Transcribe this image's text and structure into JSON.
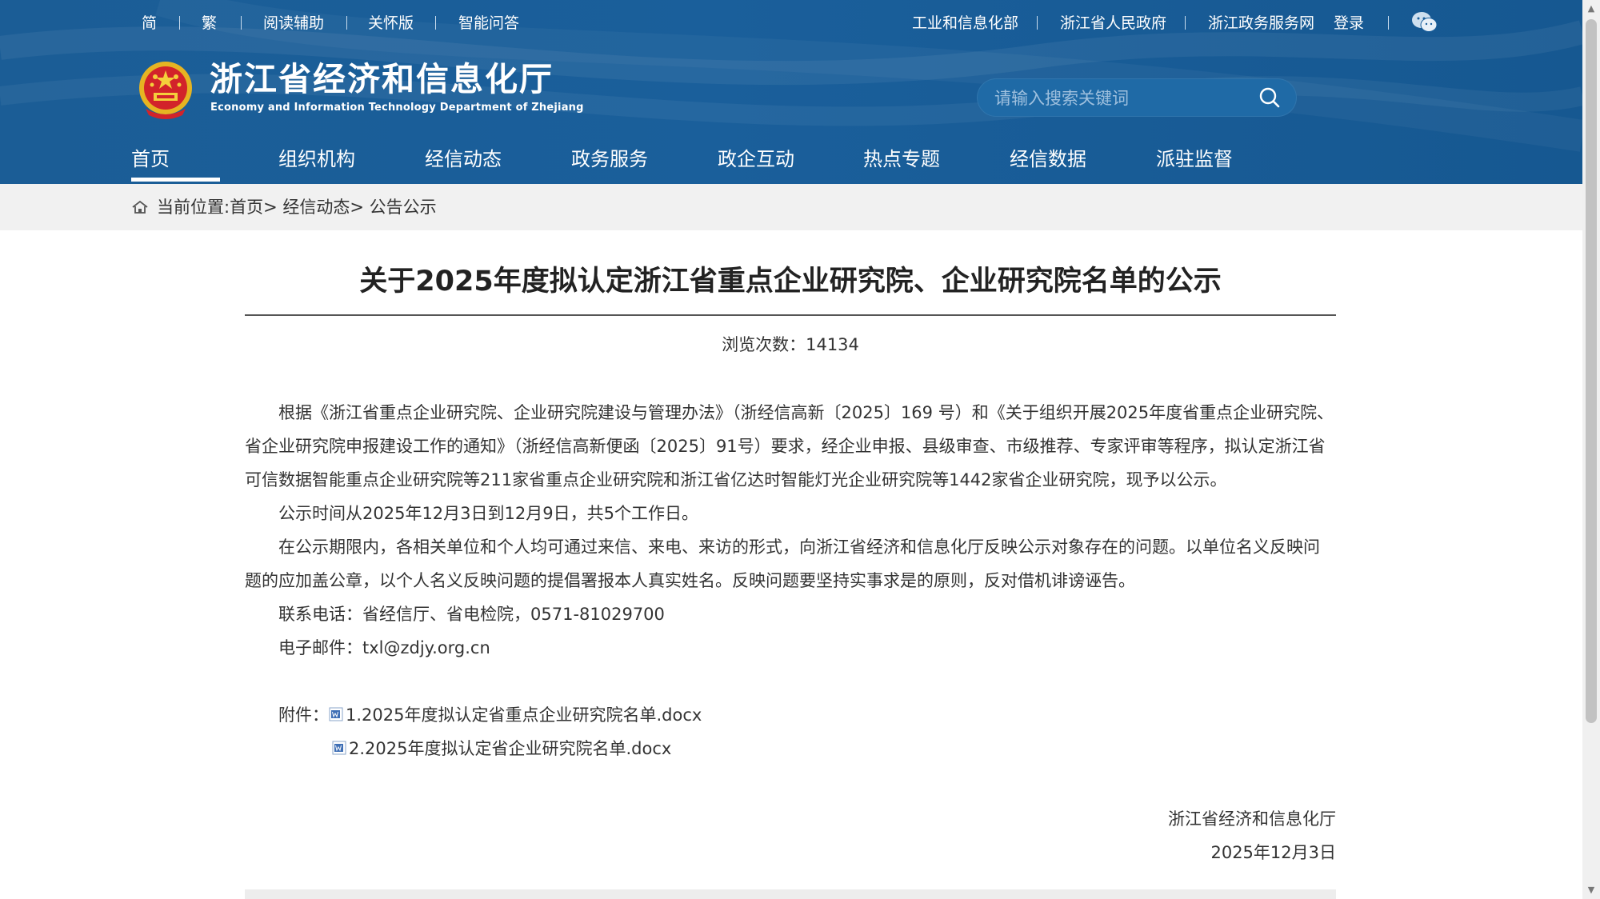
{
  "topbar": {
    "left": [
      "简",
      "繁",
      "阅读辅助",
      "关怀版",
      "智能问答"
    ],
    "right": [
      "工业和信息化部",
      "浙江省人民政府",
      "浙江政务服务网",
      "登录"
    ],
    "wechat_icon": "wechat-icon"
  },
  "logo": {
    "title_cn": "浙江省经济和信息化厅",
    "title_en": "Economy and Information Technology Department of Zhejiang",
    "emblem_icon": "national-emblem-icon"
  },
  "search": {
    "placeholder": "请输入搜索关键词",
    "icon": "search-icon"
  },
  "nav": {
    "items": [
      "首页",
      "组织机构",
      "经信动态",
      "政务服务",
      "政企互动",
      "热点专题",
      "经信数据",
      "派驻监督"
    ],
    "active_index": 0
  },
  "breadcrumb": {
    "home_icon": "home-icon",
    "text": "当前位置:首页> 经信动态> 公告公示"
  },
  "article": {
    "title": "关于2025年度拟认定浙江省重点企业研究院、企业研究院名单的公示",
    "views": "浏览次数：14134",
    "paragraphs": [
      "根据《浙江省重点企业研究院、企业研究院建设与管理办法》（浙经信高新〔2025〕169 号）和《关于组织开展2025年度省重点企业研究院、省企业研究院申报建设工作的通知》（浙经信高新便函〔2025〕91号）要求，经企业申报、县级审查、市级推荐、专家评审等程序，拟认定浙江省可信数据智能重点企业研究院等211家省重点企业研究院和浙江省亿达时智能灯光企业研究院等1442家省企业研究院，现予以公示。",
      "公示时间从2025年12月3日到12月9日，共5个工作日。",
      "在公示期限内，各相关单位和个人均可通过来信、来电、来访的形式，向浙江省经济和信息化厅反映公示对象存在的问题。以单位名义反映问题的应加盖公章，以个人名义反映问题的提倡署报本人真实姓名。反映问题要坚持实事求是的原则，反对借机诽谤诬告。",
      "联系电话：省经信厅、省电检院，0571-81029700",
      "电子邮件：txl@zdjy.org.cn"
    ],
    "attachments_label": "附件：",
    "attachments": [
      "1.2025年度拟认定省重点企业研究院名单.docx",
      "2.2025年度拟认定省企业研究院名单.docx"
    ],
    "signature_org": "浙江省经济和信息化厅",
    "signature_date": "2025年12月3日"
  },
  "colors": {
    "header_blue": "#1a5f9b",
    "crumb_bg": "#f1f1f1",
    "text": "#333333"
  }
}
